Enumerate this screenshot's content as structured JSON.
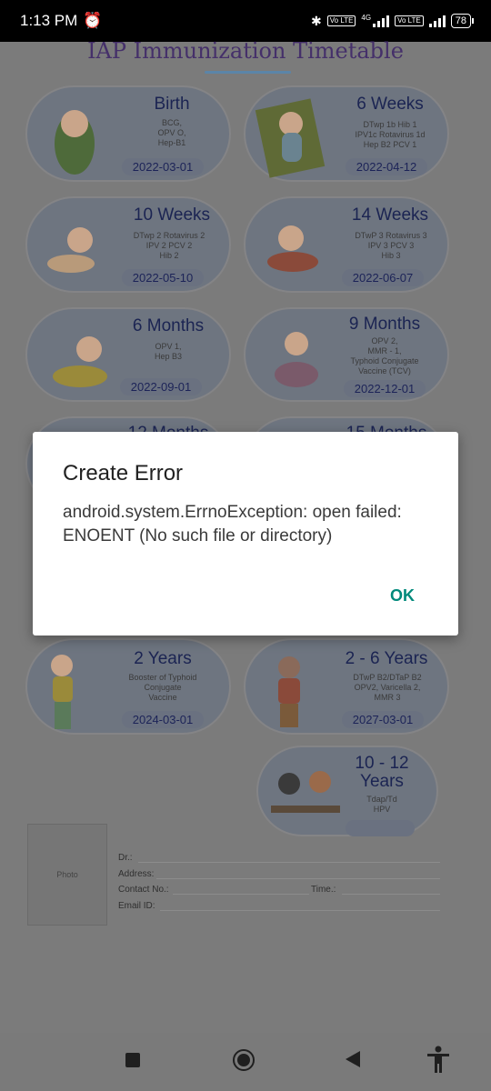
{
  "status_bar": {
    "time": "1:13 PM",
    "battery": "78",
    "net1": "Vo LTE",
    "net2": "Vo LTE",
    "net_4g": "4G"
  },
  "app": {
    "title": "IAP Immunization Timetable",
    "cards": [
      {
        "heading": "Birth",
        "vaccines": "BCG,\nOPV O,\nHep-B1",
        "date": "2022-03-01"
      },
      {
        "heading": "6 Weeks",
        "vaccines": "DTwp 1b   Hib 1\nIPV1c   Rotavirus 1d\nHep B2   PCV 1",
        "date": "2022-04-12"
      },
      {
        "heading": "10 Weeks",
        "vaccines": "DTwp 2   Rotavirus 2\nIPV 2   PCV 2\nHib 2",
        "date": "2022-05-10"
      },
      {
        "heading": "14 Weeks",
        "vaccines": "DTwP 3   Rotavirus 3\nIPV 3   PCV 3\nHib 3",
        "date": "2022-06-07"
      },
      {
        "heading": "6 Months",
        "vaccines": "OPV 1,\nHep B3",
        "date": "2022-09-01"
      },
      {
        "heading": "9 Months",
        "vaccines": "OPV 2,\nMMR - 1,\nTyphoid Conjugate\nVaccine (TCV)",
        "date": "2022-12-01"
      },
      {
        "heading": "12 Months",
        "vaccines": "",
        "date": ""
      },
      {
        "heading": "15 Months",
        "vaccines": "",
        "date": ""
      },
      {
        "heading": "2 Years",
        "vaccines": "Booster of Typhoid\nConjugate\nVaccine",
        "date": "2024-03-01"
      },
      {
        "heading": "2 - 6 Years",
        "vaccines": "DTwP B2/DTaP B2\nOPV2, Varicella 2,\nMMR 3",
        "date": "2027-03-01"
      },
      {
        "heading": "10 - 12\nYears",
        "vaccines": "Tdap/Td\nHPV",
        "date": ""
      }
    ],
    "footer": {
      "photo_label": "Photo",
      "doctor_label": "Dr.:",
      "address_label": "Address:",
      "contact_label": "Contact No.:",
      "time_label": "Time.:",
      "email_label": "Email ID:"
    }
  },
  "dialog": {
    "title": "Create Error",
    "message": "android.system.ErrnoException: open failed: ENOENT (No such file or directory)",
    "ok_label": "OK"
  }
}
